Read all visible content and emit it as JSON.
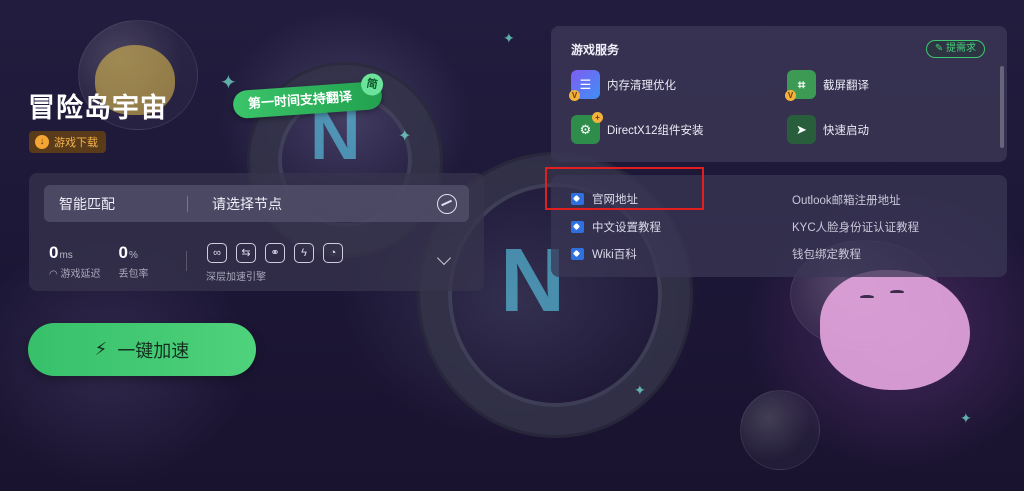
{
  "game": {
    "title": "冒险岛宇宙",
    "download_label": "游戏下载",
    "promo_label": "第一时间支持翻译",
    "promo_tag": "简"
  },
  "node_panel": {
    "match_label": "智能匹配",
    "select_label": "请选择节点",
    "latency": {
      "value": "0",
      "unit": "ms",
      "label": "游戏延迟"
    },
    "packet_loss": {
      "value": "0",
      "unit": "%",
      "label": "丢包率"
    },
    "boost_icons": [
      "link-icon",
      "route-icon",
      "network-icon",
      "bolt-icon",
      "timer-icon"
    ],
    "boost_label": "深层加速引擎"
  },
  "accelerate_button": {
    "label": "一键加速"
  },
  "services": {
    "title": "游戏服务",
    "request_label": "提需求",
    "items": [
      {
        "label": "内存清理优化",
        "icon": "memory-clean-icon"
      },
      {
        "label": "截屏翻译",
        "icon": "screenshot-translate-icon"
      },
      {
        "label": "DirectX12组件安装",
        "icon": "directx-install-icon"
      },
      {
        "label": "快速启动",
        "icon": "quick-launch-icon"
      }
    ]
  },
  "links": {
    "left": [
      {
        "label": "官网地址"
      },
      {
        "label": "中文设置教程"
      },
      {
        "label": "Wiki百科"
      }
    ],
    "right": [
      {
        "label": "Outlook邮箱注册地址"
      },
      {
        "label": "KYC人脸身份证认证教程"
      },
      {
        "label": "钱包绑定教程"
      }
    ]
  },
  "colors": {
    "accent_green": "#3fc870",
    "highlight_red": "#e02020",
    "download_orange": "#f5b34c",
    "link_blue": "#2f6fe0"
  }
}
